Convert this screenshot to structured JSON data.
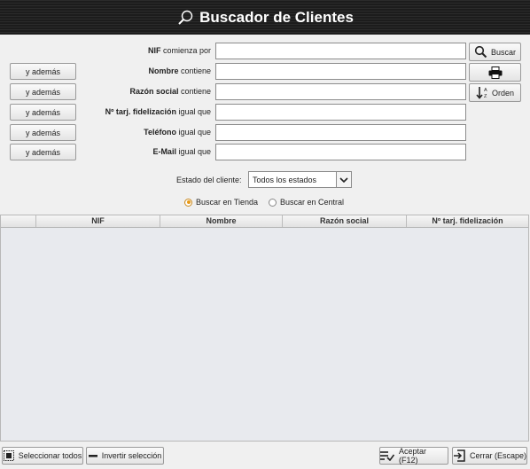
{
  "window": {
    "title": "Buscador de Clientes"
  },
  "filters": [
    {
      "bold": "NIF",
      "suffix": " comienza por",
      "value": "",
      "extra_button": ""
    },
    {
      "bold": "Nombre",
      "suffix": " contiene",
      "value": "",
      "extra_button": "y además"
    },
    {
      "bold": "Razón social",
      "suffix": " contiene",
      "value": "",
      "extra_button": "y además"
    },
    {
      "bold": "Nº tarj. fidelización",
      "suffix": " igual que",
      "value": "",
      "extra_button": "y además"
    },
    {
      "bold": "Teléfono",
      "suffix": " igual que",
      "value": "",
      "extra_button": "y además"
    },
    {
      "bold": "E-Mail",
      "suffix": " igual que",
      "value": "",
      "extra_button": "y además"
    }
  ],
  "side_buttons": {
    "search_label": "Buscar",
    "sort_label": "Orden"
  },
  "estado": {
    "label": "Estado del cliente:",
    "selected": "Todos los estados"
  },
  "search_scope": {
    "tienda": "Buscar en Tienda",
    "central": "Buscar en Central",
    "selected": "tienda"
  },
  "table": {
    "columns": [
      "",
      "NIF",
      "Nombre",
      "Razón social",
      "Nº tarj. fidelización"
    ],
    "rows": []
  },
  "bottom": {
    "select_all": "Seleccionar todos",
    "invert": "Invertir selección",
    "accept": "Aceptar (F12)",
    "close": "Cerrar (Escape)"
  }
}
